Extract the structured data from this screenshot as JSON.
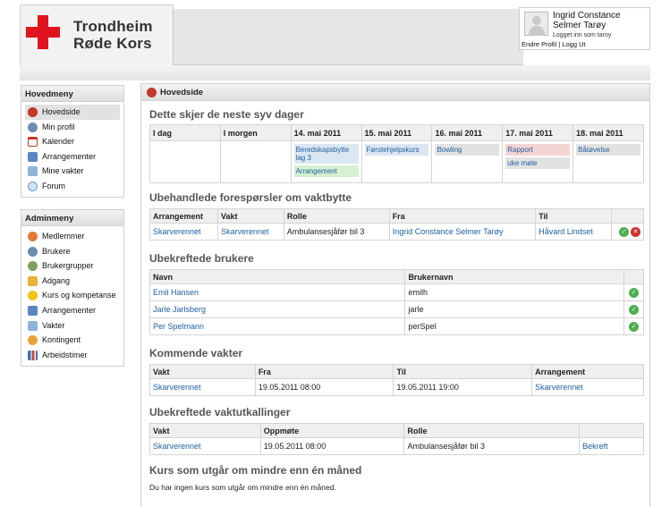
{
  "brand": {
    "line1": "Trondheim",
    "line2": "Røde Kors"
  },
  "user": {
    "name": "Ingrid Constance Selmer Tarøy",
    "logged_in": "Logget inn som taroy",
    "links": "Endre Profil | Logg Ut"
  },
  "main_menu": {
    "title": "Hovedmeny",
    "items": [
      {
        "label": "Hovedside",
        "icon": "home-icon"
      },
      {
        "label": "Min profil",
        "icon": "user-icon"
      },
      {
        "label": "Kalender",
        "icon": "calendar-icon"
      },
      {
        "label": "Arrangementer",
        "icon": "document-icon"
      },
      {
        "label": "Mine vakter",
        "icon": "shift-icon"
      },
      {
        "label": "Forum",
        "icon": "chat-icon"
      }
    ]
  },
  "admin_menu": {
    "title": "Adminmeny",
    "items": [
      {
        "label": "Medlemmer",
        "icon": "member-icon"
      },
      {
        "label": "Brukere",
        "icon": "users-icon"
      },
      {
        "label": "Brukergrupper",
        "icon": "group-icon"
      },
      {
        "label": "Adgang",
        "icon": "lock-icon"
      },
      {
        "label": "Kurs og kompetanse",
        "icon": "star-icon"
      },
      {
        "label": "Arrangementer",
        "icon": "document-icon"
      },
      {
        "label": "Vakter",
        "icon": "shift-icon"
      },
      {
        "label": "Kontingent",
        "icon": "coins-icon"
      },
      {
        "label": "Arbeidstimer",
        "icon": "bar-chart-icon"
      }
    ]
  },
  "page": {
    "title": "Hovedside"
  },
  "week": {
    "title": "Dette skjer de neste syv dager",
    "days": [
      "I dag",
      "I morgen",
      "14. mai 2011",
      "15. mai 2011",
      "16. mai 2011",
      "17. mai 2011",
      "18. mai 2011"
    ],
    "events": [
      [],
      [],
      [
        {
          "label": "Beredskapsbytte lag 3",
          "color": "blue"
        },
        {
          "label": "Arrangement",
          "color": "green"
        }
      ],
      [
        {
          "label": "Førstehjelpskurs",
          "color": "blue"
        }
      ],
      [
        {
          "label": "Bowling",
          "color": "grey"
        }
      ],
      [
        {
          "label": "Rapport",
          "color": "pink"
        },
        {
          "label": "uke møte",
          "color": "grey"
        }
      ],
      [
        {
          "label": "Båtøvelse",
          "color": "grey"
        }
      ]
    ]
  },
  "requests": {
    "title": "Ubehandlede forespørsler om vaktbytte",
    "headers": [
      "Arrangement",
      "Vakt",
      "Rolle",
      "Fra",
      "Til"
    ],
    "rows": [
      [
        "Skarverennet",
        "Skarverennet",
        "Ambulansesjåfør bil 3",
        "Ingrid Constance Selmer Tarøy",
        "Håvard Lindset"
      ]
    ]
  },
  "unconfirmed_users": {
    "title": "Ubekreftede brukere",
    "headers": [
      "Navn",
      "Brukernavn"
    ],
    "rows": [
      [
        "Emil Hansen",
        "emilh"
      ],
      [
        "Jarle Jarlsberg",
        "jarle"
      ],
      [
        "Per Spelmann",
        "perSpel"
      ]
    ]
  },
  "upcoming_shifts": {
    "title": "Kommende vakter",
    "headers": [
      "Vakt",
      "Fra",
      "Til",
      "Arrangement"
    ],
    "rows": [
      [
        "Skarverennet",
        "19.05.2011 08:00",
        "19.05.2011 19:00",
        "Skarverennet"
      ]
    ]
  },
  "unconfirmed_calls": {
    "title": "Ubekreftede vaktutkallinger",
    "headers": [
      "Vakt",
      "Oppmøte",
      "Rolle"
    ],
    "rows": [
      [
        "Skarverennet",
        "19.05.2011 08:00",
        "Ambulansesjåfør bil 3",
        "Bekreft"
      ]
    ]
  },
  "courses": {
    "title": "Kurs som utgår om mindre enn én måned",
    "empty": "Du har ingen kurs som utgår om mindre enn én måned."
  },
  "colors": {
    "accent": "#1f5fa0",
    "brand_red": "#e0141e"
  }
}
